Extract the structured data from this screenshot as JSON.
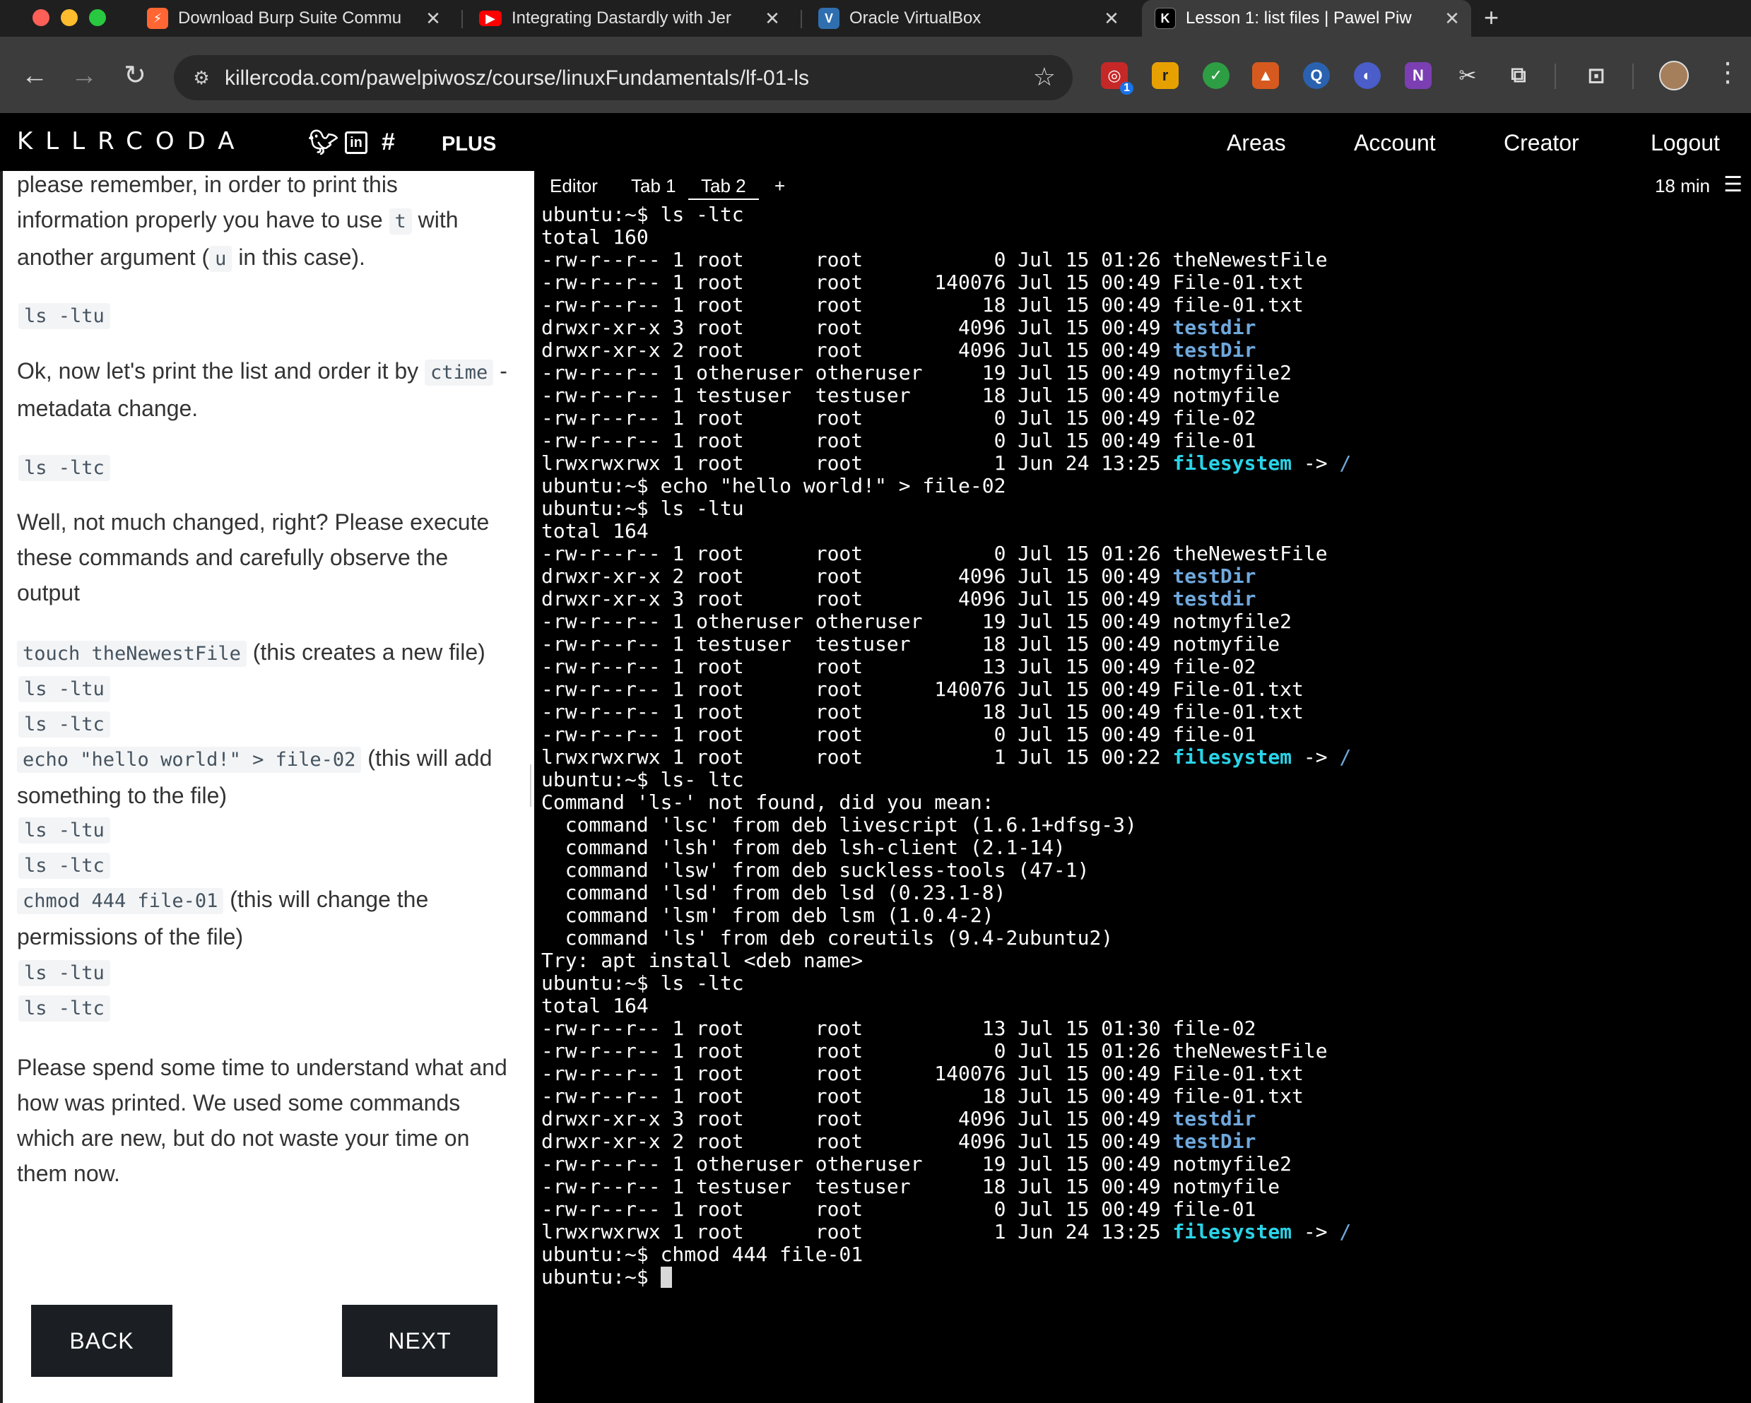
{
  "browser": {
    "tabs": [
      {
        "title": "Download Burp Suite Commu",
        "favicon": "burp-icon",
        "color": "#ff6633"
      },
      {
        "title": "Integrating Dastardly with Jer",
        "favicon": "youtube-icon",
        "color": "#ff0000"
      },
      {
        "title": "Oracle VirtualBox",
        "favicon": "virtualbox-icon",
        "color": "#2f6fb0"
      },
      {
        "title": "Lesson 1: list files | Pawel Piw",
        "favicon": "killercoda-icon",
        "color": "#000000"
      }
    ],
    "url": "killercoda.com/pawelpiwosz/course/linuxFundamentals/lf-01-ls",
    "extension_badge": "1"
  },
  "site": {
    "logo": "KLLRCODA",
    "plus": "PLUS",
    "nav": [
      "Areas",
      "Account",
      "Creator",
      "Logout"
    ]
  },
  "lesson": {
    "intro_1": "please remember, in order to print this information properly you have to use ",
    "intro_code_t": "t",
    "intro_2": " with another argument (",
    "intro_code_u": "u",
    "intro_3": " in this case).",
    "cmd_ltu": "ls -ltu",
    "para_ctime_1": "Ok, now let's print the list and order it by ",
    "para_ctime_code": "ctime",
    "para_ctime_2": " - metadata change.",
    "cmd_ltc": "ls -ltc",
    "para_well": "Well, not much changed, right? Please execute these commands and carefully observe the output",
    "cmd_touch": "touch theNewestFile",
    "note_touch": " (this creates a new file)",
    "cmd_echo": "echo \"hello world!\" > file-02",
    "note_echo": " (this will add something to the file)",
    "cmd_chmod": "chmod 444 file-01",
    "note_chmod": " (this will change the permissions of the file)",
    "para_end": "Please spend some time to understand what and how was printed. We used some commands which are new, but do not waste your time on them now.",
    "back": "BACK",
    "next": "NEXT"
  },
  "terminal": {
    "tabs": [
      "Editor",
      "Tab 1",
      "Tab 2",
      "+"
    ],
    "active_tab": "Tab 2",
    "timer": "18 min",
    "prompt": "ubuntu:~$ ",
    "lines": [
      [
        {
          "t": "ubuntu:~$ ls -ltc"
        }
      ],
      [
        {
          "t": "total 160"
        }
      ],
      [
        {
          "t": "-rw-r--r-- 1 root      root           0 Jul 15 01:26 theNewestFile"
        }
      ],
      [
        {
          "t": "-rw-r--r-- 1 root      root      140076 Jul 15 00:49 File-01.txt"
        }
      ],
      [
        {
          "t": "-rw-r--r-- 1 root      root          18 Jul 15 00:49 file-01.txt"
        }
      ],
      [
        {
          "t": "drwxr-xr-x 3 root      root        4096 Jul 15 00:49 "
        },
        {
          "t": "testdir",
          "c": "dir"
        }
      ],
      [
        {
          "t": "drwxr-xr-x 2 root      root        4096 Jul 15 00:49 "
        },
        {
          "t": "testDir",
          "c": "dir"
        }
      ],
      [
        {
          "t": "-rw-r--r-- 1 otheruser otheruser     19 Jul 15 00:49 notmyfile2"
        }
      ],
      [
        {
          "t": "-rw-r--r-- 1 testuser  testuser      18 Jul 15 00:49 notmyfile"
        }
      ],
      [
        {
          "t": "-rw-r--r-- 1 root      root           0 Jul 15 00:49 file-02"
        }
      ],
      [
        {
          "t": "-rw-r--r-- 1 root      root           0 Jul 15 00:49 file-01"
        }
      ],
      [
        {
          "t": "lrwxrwxrwx 1 root      root           1 Jun 24 13:25 "
        },
        {
          "t": "filesystem",
          "c": "lnk"
        },
        {
          "t": " -> "
        },
        {
          "t": "/",
          "c": "arrow-target"
        }
      ],
      [
        {
          "t": "ubuntu:~$ echo \"hello world!\" > file-02"
        }
      ],
      [
        {
          "t": "ubuntu:~$ ls -ltu"
        }
      ],
      [
        {
          "t": "total 164"
        }
      ],
      [
        {
          "t": "-rw-r--r-- 1 root      root           0 Jul 15 01:26 theNewestFile"
        }
      ],
      [
        {
          "t": "drwxr-xr-x 2 root      root        4096 Jul 15 00:49 "
        },
        {
          "t": "testDir",
          "c": "dir"
        }
      ],
      [
        {
          "t": "drwxr-xr-x 3 root      root        4096 Jul 15 00:49 "
        },
        {
          "t": "testdir",
          "c": "dir"
        }
      ],
      [
        {
          "t": "-rw-r--r-- 1 otheruser otheruser     19 Jul 15 00:49 notmyfile2"
        }
      ],
      [
        {
          "t": "-rw-r--r-- 1 testuser  testuser      18 Jul 15 00:49 notmyfile"
        }
      ],
      [
        {
          "t": "-rw-r--r-- 1 root      root          13 Jul 15 00:49 file-02"
        }
      ],
      [
        {
          "t": "-rw-r--r-- 1 root      root      140076 Jul 15 00:49 File-01.txt"
        }
      ],
      [
        {
          "t": "-rw-r--r-- 1 root      root          18 Jul 15 00:49 file-01.txt"
        }
      ],
      [
        {
          "t": "-rw-r--r-- 1 root      root           0 Jul 15 00:49 file-01"
        }
      ],
      [
        {
          "t": "lrwxrwxrwx 1 root      root           1 Jul 15 00:22 "
        },
        {
          "t": "filesystem",
          "c": "lnk"
        },
        {
          "t": " -> "
        },
        {
          "t": "/",
          "c": "arrow-target"
        }
      ],
      [
        {
          "t": "ubuntu:~$ ls- ltc"
        }
      ],
      [
        {
          "t": "Command 'ls-' not found, did you mean:"
        }
      ],
      [
        {
          "t": "  command 'lsc' from deb livescript (1.6.1+dfsg-3)"
        }
      ],
      [
        {
          "t": "  command 'lsh' from deb lsh-client (2.1-14)"
        }
      ],
      [
        {
          "t": "  command 'lsw' from deb suckless-tools (47-1)"
        }
      ],
      [
        {
          "t": "  command 'lsd' from deb lsd (0.23.1-8)"
        }
      ],
      [
        {
          "t": "  command 'lsm' from deb lsm (1.0.4-2)"
        }
      ],
      [
        {
          "t": "  command 'ls' from deb coreutils (9.4-2ubuntu2)"
        }
      ],
      [
        {
          "t": "Try: apt install <deb name>"
        }
      ],
      [
        {
          "t": "ubuntu:~$ ls -ltc"
        }
      ],
      [
        {
          "t": "total 164"
        }
      ],
      [
        {
          "t": "-rw-r--r-- 1 root      root          13 Jul 15 01:30 file-02"
        }
      ],
      [
        {
          "t": "-rw-r--r-- 1 root      root           0 Jul 15 01:26 theNewestFile"
        }
      ],
      [
        {
          "t": "-rw-r--r-- 1 root      root      140076 Jul 15 00:49 File-01.txt"
        }
      ],
      [
        {
          "t": "-rw-r--r-- 1 root      root          18 Jul 15 00:49 file-01.txt"
        }
      ],
      [
        {
          "t": "drwxr-xr-x 3 root      root        4096 Jul 15 00:49 "
        },
        {
          "t": "testdir",
          "c": "dir"
        }
      ],
      [
        {
          "t": "drwxr-xr-x 2 root      root        4096 Jul 15 00:49 "
        },
        {
          "t": "testDir",
          "c": "dir"
        }
      ],
      [
        {
          "t": "-rw-r--r-- 1 otheruser otheruser     19 Jul 15 00:49 notmyfile2"
        }
      ],
      [
        {
          "t": "-rw-r--r-- 1 testuser  testuser      18 Jul 15 00:49 notmyfile"
        }
      ],
      [
        {
          "t": "-rw-r--r-- 1 root      root           0 Jul 15 00:49 file-01"
        }
      ],
      [
        {
          "t": "lrwxrwxrwx 1 root      root           1 Jun 24 13:25 "
        },
        {
          "t": "filesystem",
          "c": "lnk"
        },
        {
          "t": " -> "
        },
        {
          "t": "/",
          "c": "arrow-target"
        }
      ],
      [
        {
          "t": "ubuntu:~$ chmod 444 file-01"
        }
      ],
      [
        {
          "t": "ubuntu:~$ "
        }
      ]
    ]
  },
  "colors": {
    "terminal_bg": "#000000",
    "dir": "#6fa8dc",
    "link": "#29d4e8",
    "button_bg": "#1b1f23"
  }
}
